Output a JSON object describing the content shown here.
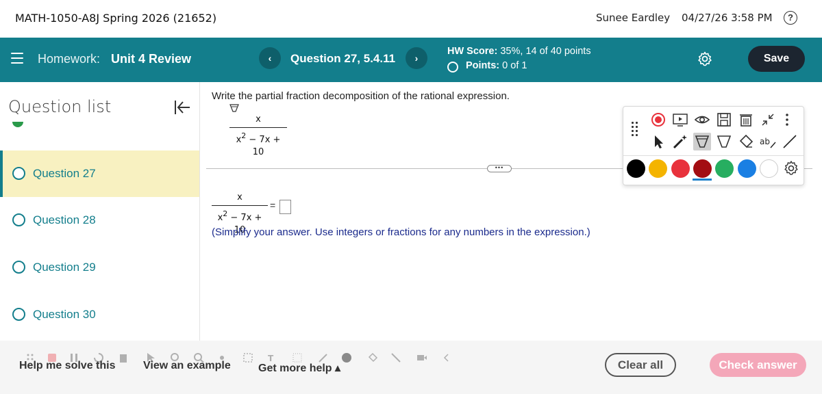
{
  "topbar": {
    "course": "MATH-1050-A8J Spring 2026 (21652)",
    "user": "Sunee Eardley",
    "datetime": "04/27/26 3:58 PM",
    "help_glyph": "?"
  },
  "header": {
    "homework_label": "Homework:",
    "homework_title": "Unit 4 Review",
    "question_label": "Question 27, 5.4.11",
    "prev_glyph": "‹",
    "next_glyph": "›",
    "score_label": "HW Score:",
    "score_value": "35%, 14 of 40 points",
    "points_label": "Points:",
    "points_value": "0 of 1",
    "save_label": "Save"
  },
  "sidebar": {
    "title": "Question list",
    "items": [
      {
        "label": "Question 27",
        "active": true
      },
      {
        "label": "Question 28",
        "active": false
      },
      {
        "label": "Question 29",
        "active": false
      },
      {
        "label": "Question 30",
        "active": false
      }
    ]
  },
  "main": {
    "instruction": "Write the partial fraction decomposition of the rational expression.",
    "expr_numerator": "x",
    "expr_den_base": "x",
    "expr_den_exp": "2",
    "expr_den_rest": " − 7x + 10",
    "equals": "=",
    "dots": "•••",
    "simplify_note": "(Simplify your answer. Use integers or fractions for any numbers in the expression.)"
  },
  "annotation_toolbar": {
    "colors": [
      "#000000",
      "#f4b400",
      "#e8323c",
      "#a30d12",
      "#27ae60",
      "#1a7fe3",
      "#ffffff"
    ],
    "selected_color": "#a30d12",
    "text_tool_glyph": "ab"
  },
  "bottom": {
    "help_me_solve": "Help me solve this",
    "view_example": "View an example",
    "get_more_help": "Get more help ▴",
    "clear_all": "Clear all",
    "check_answer": "Check answer"
  }
}
